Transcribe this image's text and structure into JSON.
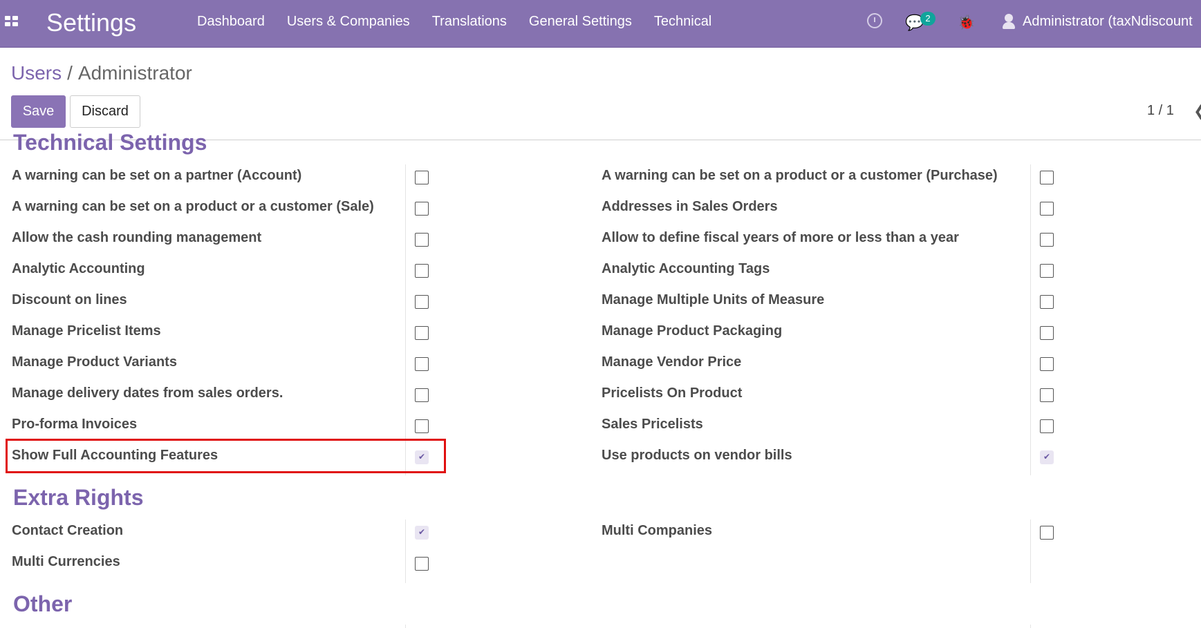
{
  "topbar": {
    "app_title": "Settings",
    "menu": [
      "Dashboard",
      "Users & Companies",
      "Translations",
      "General Settings",
      "Technical"
    ],
    "chat_count": "2",
    "user_name": "Administrator (taxNdiscount",
    "color": "#8672b0"
  },
  "breadcrumb": {
    "parent": "Users",
    "separator": "/",
    "current": "Administrator"
  },
  "actions": {
    "save": "Save",
    "discard": "Discard"
  },
  "pager": {
    "text": "1 / 1"
  },
  "technical_settings": {
    "title": "Technical Settings",
    "left": [
      {
        "label": "A warning can be set on a partner (Account)",
        "checked": false
      },
      {
        "label": "A warning can be set on a product or a customer (Sale)",
        "checked": false
      },
      {
        "label": "Allow the cash rounding management",
        "checked": false
      },
      {
        "label": "Analytic Accounting",
        "checked": false
      },
      {
        "label": "Discount on lines",
        "checked": false
      },
      {
        "label": "Manage Pricelist Items",
        "checked": false
      },
      {
        "label": "Manage Product Variants",
        "checked": false
      },
      {
        "label": "Manage delivery dates from sales orders.",
        "checked": false
      },
      {
        "label": "Pro-forma Invoices",
        "checked": false
      },
      {
        "label": "Show Full Accounting Features",
        "checked": true
      }
    ],
    "right": [
      {
        "label": "A warning can be set on a product or a customer (Purchase)",
        "checked": false
      },
      {
        "label": "Addresses in Sales Orders",
        "checked": false
      },
      {
        "label": "Allow to define fiscal years of more or less than a year",
        "checked": false
      },
      {
        "label": "Analytic Accounting Tags",
        "checked": false
      },
      {
        "label": "Manage Multiple Units of Measure",
        "checked": false
      },
      {
        "label": "Manage Product Packaging",
        "checked": false
      },
      {
        "label": "Manage Vendor Price",
        "checked": false
      },
      {
        "label": "Pricelists On Product",
        "checked": false
      },
      {
        "label": "Sales Pricelists",
        "checked": false
      },
      {
        "label": "Use products on vendor bills",
        "checked": true
      }
    ]
  },
  "extra_rights": {
    "title": "Extra Rights",
    "left": [
      {
        "label": "Contact Creation",
        "checked": true
      },
      {
        "label": "Multi Currencies",
        "checked": false
      }
    ],
    "right": [
      {
        "label": "Multi Companies",
        "checked": false
      }
    ]
  },
  "other": {
    "title": "Other"
  }
}
